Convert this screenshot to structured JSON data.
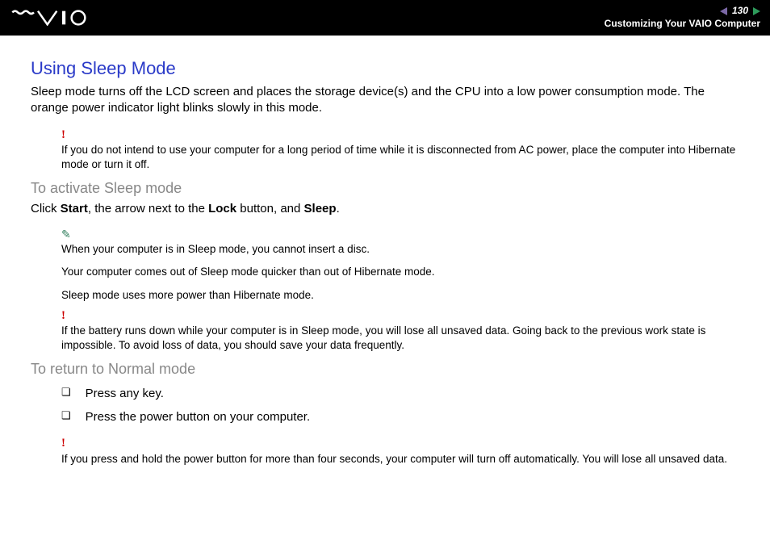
{
  "header": {
    "page_number": "130",
    "section": "Customizing Your VAIO Computer"
  },
  "content": {
    "title": "Using Sleep Mode",
    "intro": "Sleep mode turns off the LCD screen and places the storage device(s) and the CPU into a low power consumption mode. The orange power indicator light blinks slowly in this mode.",
    "warning1": "If you do not intend to use your computer for a long period of time while it is disconnected from AC power, place the computer into Hibernate mode or turn it off.",
    "activate": {
      "heading": "To activate Sleep mode",
      "instruction_pre": "Click ",
      "b1": "Start",
      "instruction_mid1": ", the arrow next to the ",
      "b2": "Lock",
      "instruction_mid2": " button, and ",
      "b3": "Sleep",
      "instruction_end": ".",
      "note1": "When your computer is in Sleep mode, you cannot insert a disc.",
      "note2": "Your computer comes out of Sleep mode quicker than out of Hibernate mode.",
      "note3": "Sleep mode uses more power than Hibernate mode.",
      "warning2": "If the battery runs down while your computer is in Sleep mode, you will lose all unsaved data. Going back to the previous work state is impossible. To avoid loss of data, you should save your data frequently."
    },
    "return": {
      "heading": "To return to Normal mode",
      "item1": "Press any key.",
      "item2": "Press the power button on your computer.",
      "warning3": "If you press and hold the power button for more than four seconds, your computer will turn off automatically. You will lose all unsaved data."
    }
  }
}
